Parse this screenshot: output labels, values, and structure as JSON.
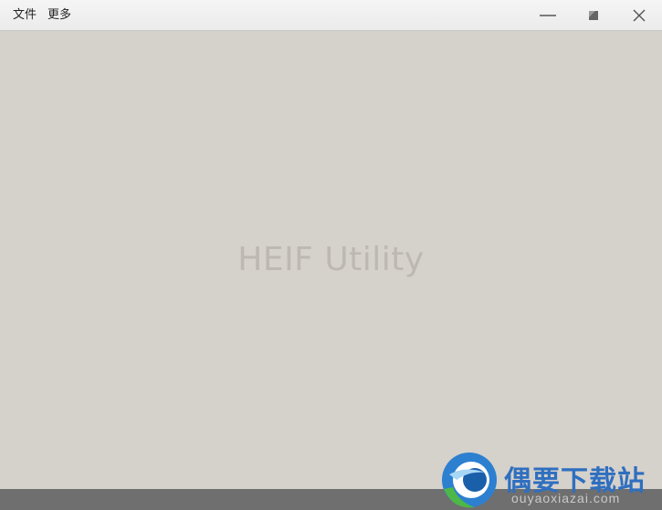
{
  "menu": {
    "file_label": "文件",
    "more_label": "更多"
  },
  "window_controls": {
    "minimize_icon": "minimize-icon",
    "restore_icon": "restore-icon",
    "close_icon": "close-icon"
  },
  "main": {
    "app_title": "HEIF Utility"
  },
  "watermark": {
    "name_cn": "偶要下载站",
    "domain": "ouyaoxiazai.com"
  },
  "colors": {
    "background": "#d5d1cb",
    "titlebar": "#efefef",
    "statusbar": "#6f6f6f",
    "title_text": "#bdb8b2",
    "watermark_blue": "#2f6fbf"
  }
}
